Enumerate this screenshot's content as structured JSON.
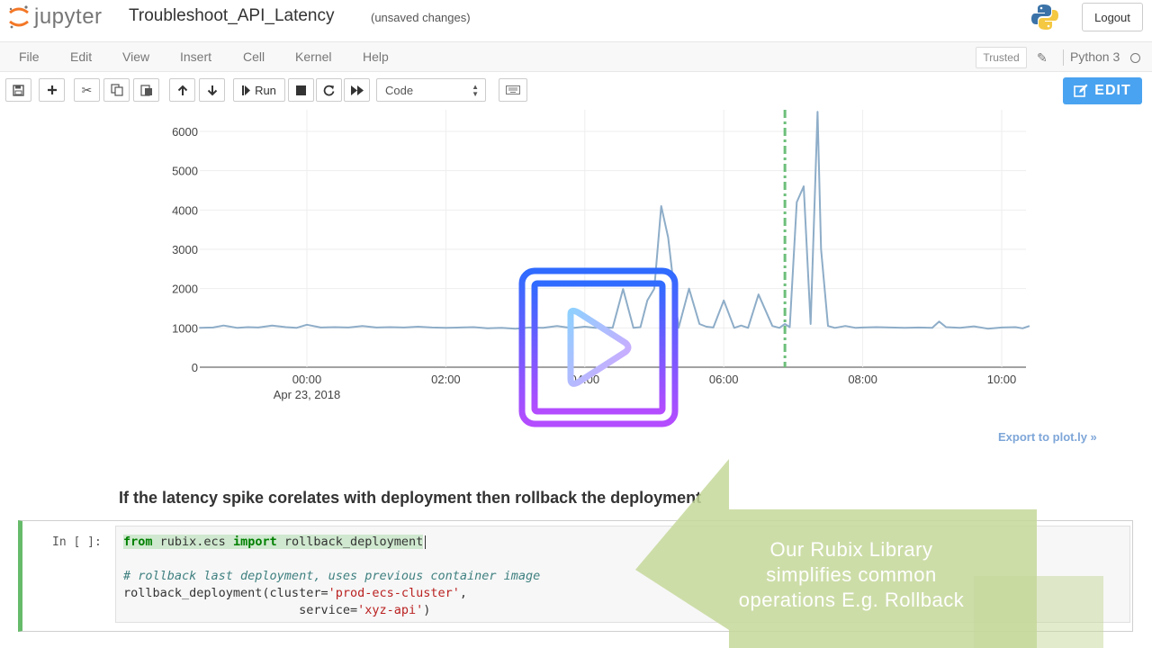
{
  "header": {
    "logo_text": "jupyter",
    "notebook_title": "Troubleshoot_API_Latency",
    "save_status": "(unsaved changes)",
    "logout_label": "Logout"
  },
  "menubar": {
    "items": [
      "File",
      "Edit",
      "View",
      "Insert",
      "Cell",
      "Kernel",
      "Help"
    ],
    "trusted_label": "Trusted",
    "kernel_name": "Python 3"
  },
  "toolbar": {
    "icons": [
      "save-icon",
      "plus-icon",
      "cut-icon",
      "copy-icon",
      "paste-icon",
      "arrow-up-icon",
      "arrow-down-icon",
      "run-icon",
      "stop-icon",
      "restart-icon",
      "fast-forward-icon",
      "keyboard-icon"
    ],
    "run_label": "Run",
    "cell_type_value": "Code",
    "edit_label": "EDIT"
  },
  "chart_data": {
    "type": "line",
    "title": "",
    "xlabel": "",
    "ylabel": "",
    "ylim": [
      0,
      6500
    ],
    "y_ticks": [
      0,
      1000,
      2000,
      3000,
      4000,
      5000,
      6000
    ],
    "x_tick_labels": [
      "00:00",
      "02:00",
      "04:00",
      "06:00",
      "08:00",
      "10:00"
    ],
    "x_date_label": "Apr 23, 2018",
    "x_range_hours": [
      -1.55,
      10.4
    ],
    "grid": true,
    "line_color": "#8eadc8",
    "marker_line": {
      "x_hours": 6.88,
      "color": "#6dbf7a",
      "style": "dash-dot"
    },
    "series": [
      {
        "x_hours": [
          -1.55,
          -1.35,
          -1.2,
          -1.0,
          -0.85,
          -0.7,
          -0.5,
          -0.3,
          -0.15,
          0.0,
          0.2,
          0.4,
          0.6,
          0.8,
          1.0,
          1.2,
          1.4,
          1.6,
          1.8,
          2.0,
          2.2,
          2.4,
          2.6,
          2.8,
          3.0,
          3.2,
          3.4,
          3.6,
          3.75,
          3.85,
          4.0,
          4.15,
          4.3,
          4.4,
          4.55,
          4.7,
          4.8,
          4.9,
          5.0,
          5.1,
          5.2,
          5.35,
          5.5,
          5.65,
          5.75,
          5.85,
          6.0,
          6.15,
          6.25,
          6.35,
          6.5,
          6.7,
          6.8,
          6.88,
          6.95,
          7.05,
          7.15,
          7.25,
          7.35,
          7.4,
          7.5,
          7.6,
          7.75,
          7.9,
          8.0,
          8.2,
          8.4,
          8.6,
          8.8,
          9.0,
          9.1,
          9.2,
          9.4,
          9.6,
          9.8,
          10.0,
          10.2,
          10.3,
          10.4
        ],
        "y": [
          1000,
          1010,
          1060,
          1000,
          1020,
          1010,
          1060,
          1020,
          1000,
          1080,
          1010,
          1020,
          1010,
          1050,
          1010,
          1020,
          1010,
          1030,
          1010,
          1000,
          1010,
          1020,
          990,
          1000,
          980,
          1010,
          1000,
          1050,
          1010,
          1000,
          1030,
          1000,
          1010,
          1000,
          1990,
          1000,
          1020,
          1700,
          2000,
          4100,
          3300,
          1000,
          2000,
          1100,
          1030,
          1010,
          1700,
          1000,
          1060,
          1000,
          1850,
          1050,
          1000,
          1100,
          1020,
          4200,
          4600,
          1100,
          6500,
          3000,
          1050,
          1000,
          1050,
          1000,
          1010,
          1020,
          1010,
          1000,
          1010,
          1000,
          1160,
          1020,
          1000,
          1040,
          980,
          1010,
          1020,
          990,
          1050
        ]
      }
    ]
  },
  "export_link": "Export to plot.ly »",
  "markdown_heading": "If the latency spike corelates with deployment then rollback the deployment",
  "code_cell": {
    "prompt": "In [ ]:",
    "line1": {
      "kw_from": "from",
      "module": "rubix.ecs",
      "kw_import": "import",
      "name": "rollback_deployment"
    },
    "comment": "# rollback last deployment, uses previous container image",
    "line3": {
      "call": "rollback_deployment(cluster=",
      "arg1": "'prod-ecs-cluster'",
      "tail": ","
    },
    "line4": {
      "indent": "                        service=",
      "arg2": "'xyz-api'",
      "tail": ")"
    }
  },
  "callout": {
    "text": "Our Rubix Library simplifies common operations E.g. Rollback",
    "color": "#c5d89a"
  },
  "play_overlay": {
    "gradient": [
      "#2f6bff",
      "#b44cff"
    ]
  }
}
